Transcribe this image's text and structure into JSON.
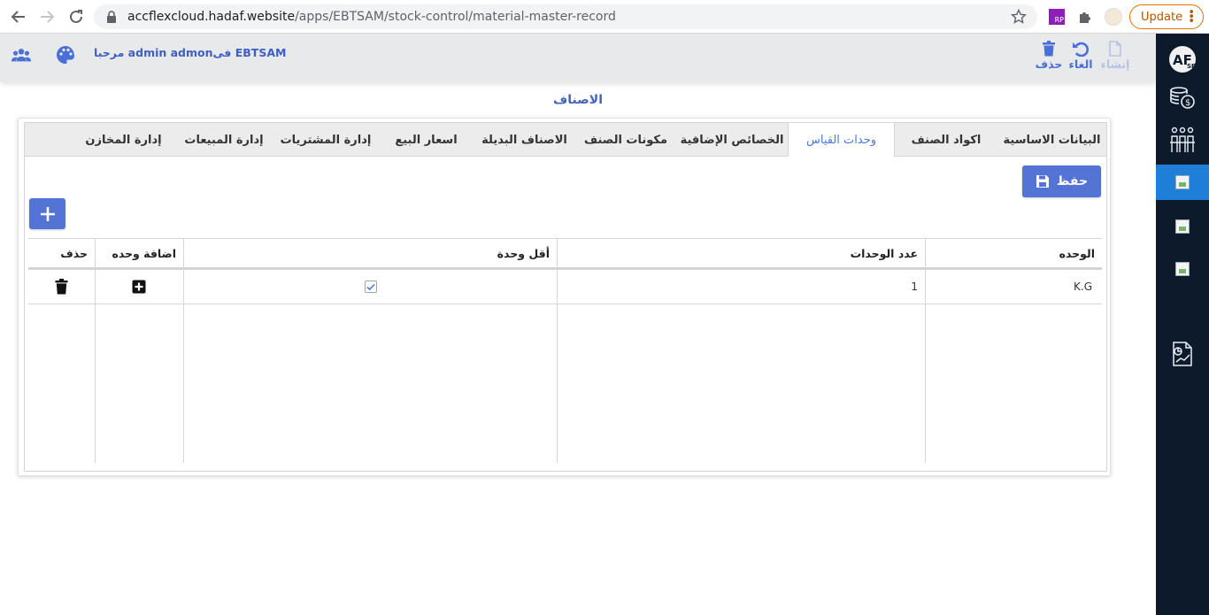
{
  "browser": {
    "url_host": "accflexcloud.hadaf.website",
    "url_path": "/apps/EBTSAM/stock-control/material-master-record",
    "update_label": "Update",
    "ext_rp_label": "RP"
  },
  "header": {
    "user_text": "مرحبا admin admonفى  EBTSAM",
    "tools": {
      "delete_label": "حذف",
      "cancel_label": "الغاء",
      "create_label": "إنشاء"
    }
  },
  "sidebar": {
    "logo_text": "AF",
    "logo_sub": "SB"
  },
  "page": {
    "title": "الاصناف"
  },
  "tabs": [
    {
      "label": "البيانات الاساسية",
      "active": false
    },
    {
      "label": "اكواد الصنف",
      "active": false
    },
    {
      "label": "وحدات القياس",
      "active": true
    },
    {
      "label": "الخصائص الإضافية",
      "active": false
    },
    {
      "label": "مكونات الصنف",
      "active": false
    },
    {
      "label": "الاصناف البديلة",
      "active": false
    },
    {
      "label": "اسعار البيع",
      "active": false
    },
    {
      "label": "إدارة المشتريات",
      "active": false
    },
    {
      "label": "إدارة المبيعات",
      "active": false
    },
    {
      "label": "إدارة المخازن",
      "active": false
    }
  ],
  "actions": {
    "save_label": "حفظ"
  },
  "grid": {
    "headers": {
      "unit": "الوحده",
      "unit_count": "عدد الوحدات",
      "min_unit": "أقل وحدة",
      "add_unit": "اضافة وحده",
      "delete": "حذف"
    },
    "rows": [
      {
        "unit": "K.G",
        "unit_count": "1",
        "min_unit": true
      }
    ]
  },
  "colors": {
    "accent": "#5474d5",
    "sidebar_bg": "#0d1a2b",
    "sidebar_active": "#1e7ed8",
    "header_bg": "#e8e9eb"
  }
}
